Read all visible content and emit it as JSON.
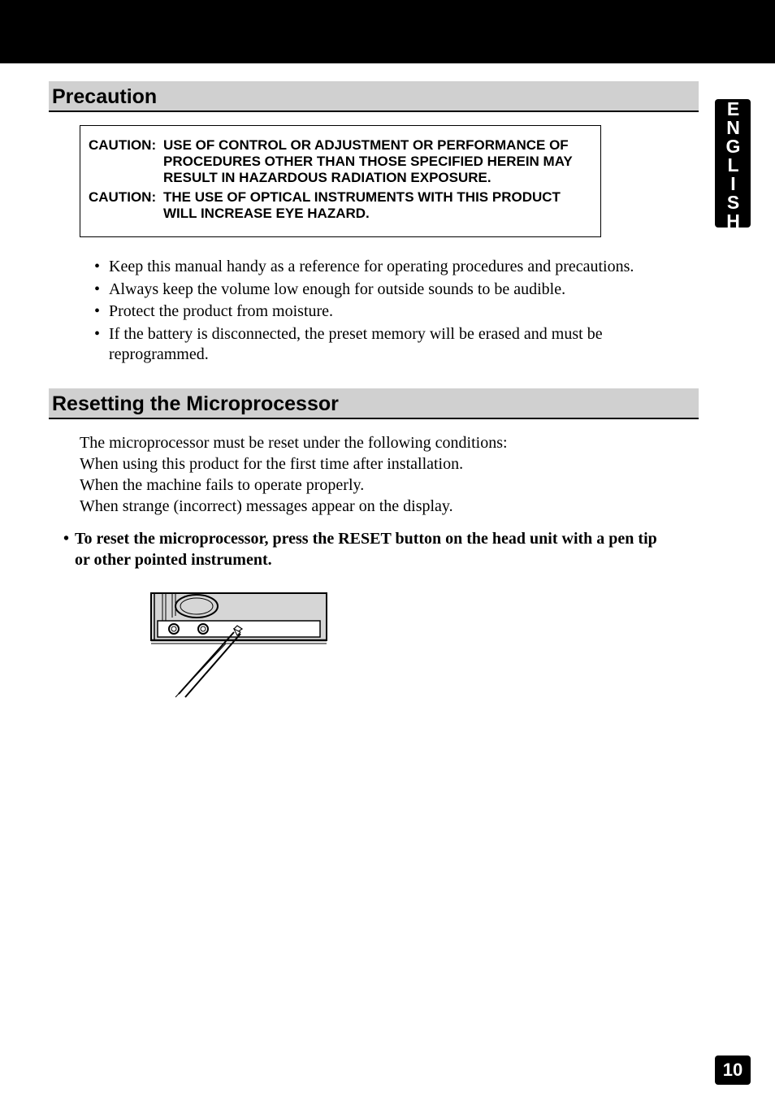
{
  "sideTab": "ENGLISH",
  "pageNumber": "10",
  "precaution": {
    "heading": "Precaution",
    "caution1Label": "CAUTION:",
    "caution1Text": "USE OF CONTROL OR ADJUSTMENT OR PERFORMANCE OF PROCEDURES OTHER THAN THOSE SPECIFIED HEREIN MAY RESULT IN HAZARDOUS RADIATION EXPOSURE.",
    "caution2Label": "CAUTION:",
    "caution2Text": "THE USE OF OPTICAL INSTRUMENTS WITH THIS PRODUCT WILL INCREASE EYE HAZARD.",
    "bullets": [
      "Keep this manual handy as a reference for operating procedures and precautions.",
      "Always keep the volume low enough for outside sounds to be audible.",
      "Protect the product from moisture.",
      "If the battery is disconnected, the preset memory will be erased and must be reprogrammed."
    ]
  },
  "resetting": {
    "heading": "Resetting the Microprocessor",
    "lines": [
      "The microprocessor must be reset under the following conditions:",
      "When using this product for the first time after installation.",
      "When the machine fails to operate properly.",
      "When strange (incorrect) messages appear on the display."
    ],
    "instruction": "To reset the microprocessor, press the RESET button on the head unit with a pen tip or other pointed instrument."
  }
}
